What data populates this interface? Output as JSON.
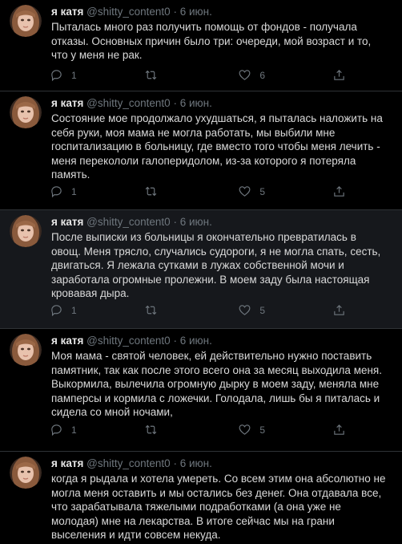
{
  "author": {
    "name": "я катя",
    "handle": "@shitty_content0",
    "separator": "·"
  },
  "tweets": [
    {
      "date": "6 июн.",
      "text": "Пыталась много раз получить помощь от фондов - получала отказы. Основных причин было три: очереди, мой возраст и то, что у меня не рак.",
      "replies": "1",
      "retweets": "",
      "likes": "6"
    },
    {
      "date": "6 июн.",
      "text": "Состояние мое продолжало ухудшаться, я пыталась наложить на себя руки, моя мама не могла работать, мы выбили мне госпитализацию в больницу, где вместо того чтобы меня лечить - меня перекололи галоперидолом, из-за которого я потеряла память.",
      "replies": "1",
      "retweets": "",
      "likes": "5"
    },
    {
      "date": "6 июн.",
      "text": "После выписки из больницы я окончательно превратилась в овощ. Меня трясло, случались судороги, я не могла спать, сесть, двигаться. Я лежала сутками в лужах собственной мочи и заработала огромные пролежни. В моем заду была настоящая кровавая дыра.",
      "replies": "1",
      "retweets": "",
      "likes": "5"
    },
    {
      "date": "6 июн.",
      "text": "Моя мама - святой человек, ей действительно нужно поставить памятник, так как после этого всего она за месяц выходила меня. Выкормила, вылечила огромную дырку в моем заду, меняла мне памперсы и кормила с ложечки. Голодала, лишь бы я питалась и сидела со мной ночами,",
      "replies": "1",
      "retweets": "",
      "likes": "5"
    },
    {
      "date": "6 июн.",
      "text": "когда я рыдала и хотела умереть. Со всем этим она абсолютно не могла меня оставить и мы остались без денег. Она отдавала все, что зарабатывала тяжелыми подработками (а она уже не молодая) мне на лекарства. В итоге сейчас мы на грани выселения и идти совсем некуда."
    }
  ],
  "colors": {
    "background": "#000000",
    "highlight_background": "#16181c",
    "muted": "#6e767d",
    "text": "#d9d9d9",
    "divider": "#2f3336"
  },
  "icons": [
    "reply-icon",
    "retweet-icon",
    "like-icon",
    "share-icon"
  ]
}
